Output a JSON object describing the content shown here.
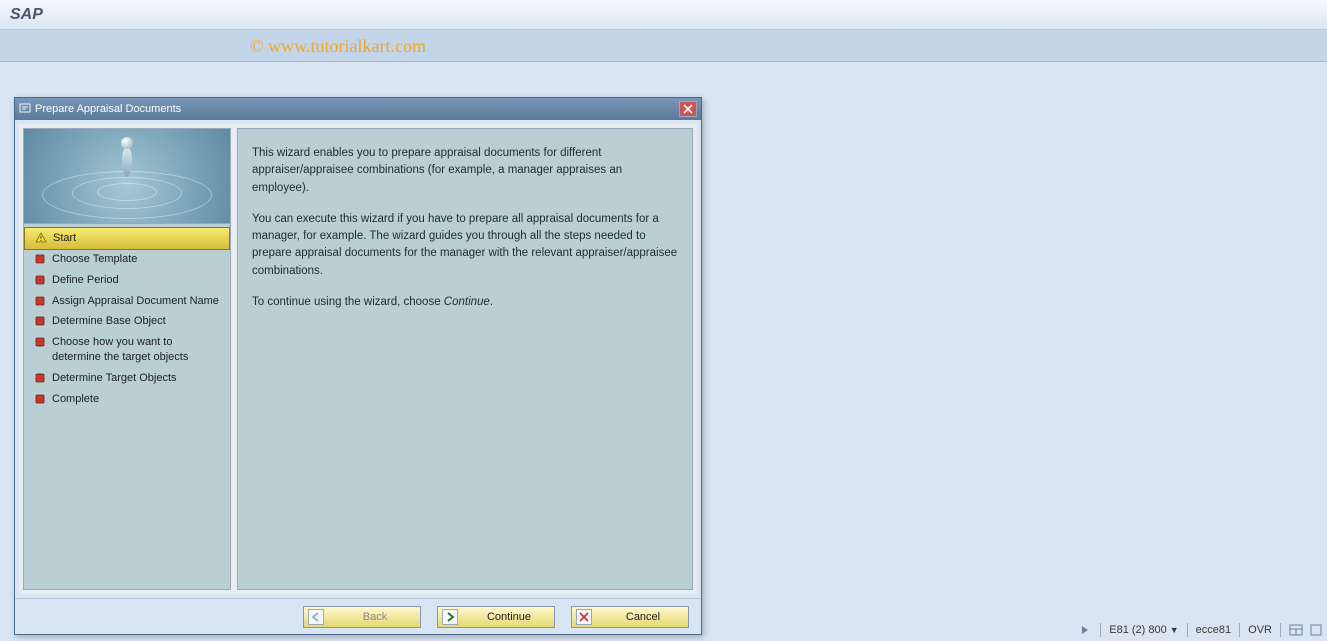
{
  "header": {
    "app_title": "SAP"
  },
  "watermark": "© www.tutorialkart.com",
  "dialog": {
    "title": "Prepare Appraisal Documents",
    "steps": [
      {
        "label": "Start",
        "state": "current"
      },
      {
        "label": "Choose Template",
        "state": "pending"
      },
      {
        "label": "Define Period",
        "state": "pending"
      },
      {
        "label": "Assign Appraisal Document Name",
        "state": "pending"
      },
      {
        "label": "Determine Base Object",
        "state": "pending"
      },
      {
        "label": "Choose how you want to determine the target objects",
        "state": "pending"
      },
      {
        "label": "Determine Target Objects",
        "state": "pending"
      },
      {
        "label": "Complete",
        "state": "pending"
      }
    ],
    "content": {
      "p1": "This wizard enables you to prepare appraisal documents for different appraiser/appraisee combinations (for example, a manager appraises an employee).",
      "p2": "You can execute this wizard if you have to prepare all appraisal documents for a manager, for example. The wizard guides you through all the steps needed to prepare appraisal documents for the manager with the relevant appraiser/appraisee combinations.",
      "p3_prefix": "To continue using the wizard, choose ",
      "p3_em": "Continue",
      "p3_suffix": "."
    },
    "buttons": {
      "back": "Back",
      "continue": "Continue",
      "cancel": "Cancel"
    }
  },
  "statusbar": {
    "system": "E81 (2) 800",
    "server": "ecce81",
    "mode": "OVR"
  }
}
